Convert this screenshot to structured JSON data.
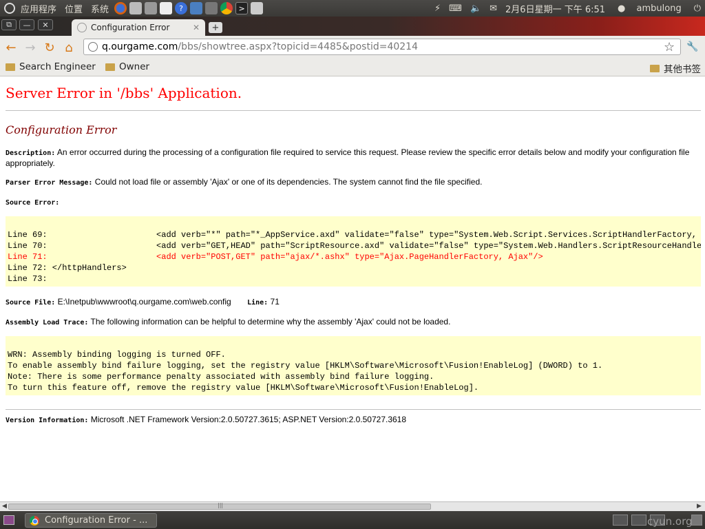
{
  "top_panel": {
    "applications": "应用程序",
    "places": "位置",
    "system": "系统",
    "datetime": "2月6日星期一 下午 6:51",
    "username": "ambulong"
  },
  "browser": {
    "tab_title": "Configuration Error",
    "url_host": "q.ourgame.com",
    "url_path": "/bbs/showtree.aspx?topicid=4485&postid=40214",
    "bookmarks": [
      "Search Engineer",
      "Owner"
    ],
    "other_bookmarks": "其他书签"
  },
  "page": {
    "heading": "Server Error in '/bbs' Application.",
    "subheading": "Configuration Error",
    "description_label": "Description:",
    "description_text": "An error occurred during the processing of a configuration file required to service this request. Please review the specific error details below and modify your configuration file appropriately.",
    "parser_label": "Parser Error Message:",
    "parser_text": "Could not load file or assembly 'Ajax' or one of its dependencies. The system cannot find the file specified.",
    "source_error_label": "Source Error:",
    "source_lines": [
      {
        "num": "Line 69:",
        "code": "                      <add verb=\"*\" path=\"*_AppService.axd\" validate=\"false\" type=\"System.Web.Script.Services.ScriptHandlerFactory, Sys",
        "error": false
      },
      {
        "num": "Line 70:",
        "code": "                      <add verb=\"GET,HEAD\" path=\"ScriptResource.axd\" validate=\"false\" type=\"System.Web.Handlers.ScriptResourceHandler,",
        "error": false
      },
      {
        "num": "Line 71:",
        "code": "                      <add verb=\"POST,GET\" path=\"ajax/*.ashx\" type=\"Ajax.PageHandlerFactory, Ajax\"/>",
        "error": true
      },
      {
        "num": "Line 72:",
        "code": " </httpHandlers>",
        "error": false
      },
      {
        "num": "Line 73:",
        "code": "",
        "error": false
      }
    ],
    "source_file_label": "Source File:",
    "source_file_value": "E:\\Inetpub\\wwwroot\\q.ourgame.com\\web.config",
    "line_label": "Line:",
    "line_value": "71",
    "trace_label": "Assembly Load Trace:",
    "trace_text": "The following information can be helpful to determine why the assembly 'Ajax' could not be loaded.",
    "trace_lines": [
      "WRN: Assembly binding logging is turned OFF.",
      "To enable assembly bind failure logging, set the registry value [HKLM\\Software\\Microsoft\\Fusion!EnableLog] (DWORD) to 1.",
      "Note: There is some performance penalty associated with assembly bind failure logging.",
      "To turn this feature off, remove the registry value [HKLM\\Software\\Microsoft\\Fusion!EnableLog]."
    ],
    "version_label": "Version Information:",
    "version_text": "Microsoft .NET Framework Version:2.0.50727.3615; ASP.NET Version:2.0.50727.3618"
  },
  "taskbar": {
    "task_label": "Configuration Error - ..."
  },
  "watermark": "cyun.org",
  "colors": {
    "heading": "#ff0000",
    "subheading": "#800000",
    "code_background": "#ffffcc"
  }
}
